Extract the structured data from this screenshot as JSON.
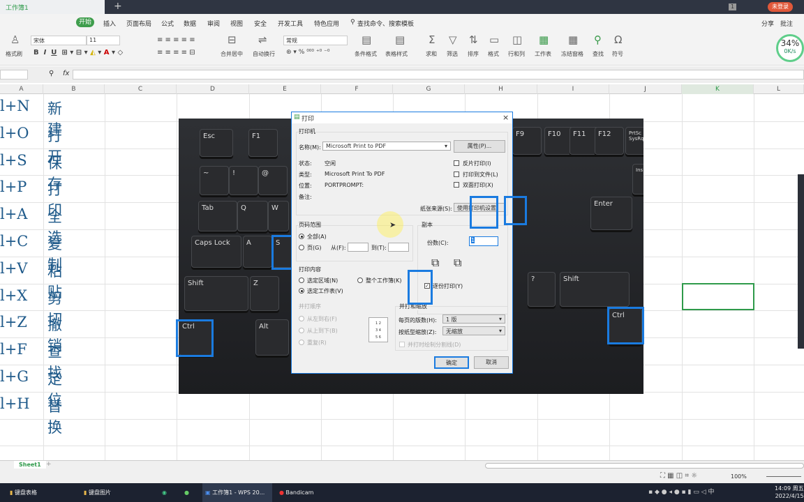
{
  "window": {
    "doc_tab": "工作簿1",
    "sheet_count_badge": "1",
    "login": "未登录"
  },
  "menu": {
    "items": [
      "开始",
      "插入",
      "页面布局",
      "公式",
      "数据",
      "审阅",
      "视图",
      "安全",
      "开发工具",
      "特色应用"
    ],
    "search": "查找命令、搜索模板",
    "share": "分享",
    "comment": "批注"
  },
  "ribbon": {
    "format_painter": "格式刷",
    "font": "宋体",
    "size": "11",
    "merge": "合并居中",
    "wrap": "自动换行",
    "number_format": "常规",
    "cond_format": "条件格式",
    "table_style": "表格样式",
    "sum": "求和",
    "filter": "筛选",
    "sort": "排序",
    "format": "格式",
    "rowcol": "行和列",
    "sheet": "工作表",
    "freeze": "冻结窗格",
    "find": "查找",
    "symbol": "符号",
    "progress": "34%",
    "speed": "0K/s"
  },
  "formula": {
    "fx": "fx"
  },
  "columns": [
    "A",
    "B",
    "C",
    "D",
    "E",
    "F",
    "G",
    "H",
    "I",
    "J",
    "K",
    "L"
  ],
  "rows": [
    {
      "a": "l+N",
      "b": "新建"
    },
    {
      "a": "l+O",
      "b": "打开"
    },
    {
      "a": "l+S",
      "b": "保存"
    },
    {
      "a": "l+P",
      "b": "打印"
    },
    {
      "a": "l+A",
      "b": "全选"
    },
    {
      "a": "l+C",
      "b": "复制"
    },
    {
      "a": "l+V",
      "b": "粘贴"
    },
    {
      "a": "l+X",
      "b": "剪切"
    },
    {
      "a": "l+Z",
      "b": "撤销"
    },
    {
      "a": "l+F",
      "b": "查找"
    },
    {
      "a": "l+G",
      "b": "定位"
    },
    {
      "a": "l+H",
      "b": "替换"
    }
  ],
  "keyboard": {
    "keys": [
      "Esc",
      "F1",
      "F9",
      "F10",
      "F11",
      "F12",
      "PrtSc SysRq",
      "~",
      "!",
      "@",
      "Tab",
      "Q",
      "W",
      "Caps Lock",
      "A",
      "S",
      "Shift",
      "Z",
      "Ctrl",
      "Alt",
      "Shift",
      "Ctrl",
      "Enter",
      "Ins",
      "?"
    ]
  },
  "dialog": {
    "title": "打印",
    "printer_group": "打印机",
    "name_label": "名称(M):",
    "name_value": "Microsoft Print to PDF",
    "properties": "属性(P)...",
    "status_label": "状态:",
    "status_value": "空闲",
    "type_label": "类型:",
    "type_value": "Microsoft Print To PDF",
    "where_label": "位置:",
    "where_value": "PORTPROMPT:",
    "comment_label": "备注:",
    "reverse": "反片打印(I)",
    "to_file": "打印到文件(L)",
    "duplex": "双面打印(X)",
    "paper_source_label": "纸张来源(S):",
    "paper_source": "使用打印机设置",
    "range_group": "页码范围",
    "all": "全部(A)",
    "pages": "页(G)",
    "from": "从(F):",
    "to": "到(T):",
    "copies_group": "副本",
    "copies_label": "份数(C):",
    "copies_value": "1",
    "collate": "逐份打印(Y)",
    "content_group": "打印内容",
    "selection": "选定区域(N)",
    "workbook": "整个工作簿(K)",
    "active_sheet": "选定工作表(V)",
    "order_group": "并打顺序",
    "ltr": "从左到右(F)",
    "ttb": "从上到下(B)",
    "repeat": "重复(R)",
    "scale_group": "并打和缩放",
    "per_page_label": "每页的版数(H):",
    "per_page": "1 版",
    "scale_label": "按纸型缩放(Z):",
    "scale": "无缩放",
    "draw_lines": "并打时绘制分割线(D)",
    "ok": "确定",
    "cancel": "取消"
  },
  "sheet": {
    "tab": "Sheet1",
    "zoom": "100%"
  },
  "taskbar": {
    "items": [
      "键盘表格",
      "键盘图片",
      "工作簿1 - WPS 20...",
      "Bandicam"
    ],
    "time": "14:09 周五",
    "date": "2022/4/15",
    "ime": "中"
  }
}
